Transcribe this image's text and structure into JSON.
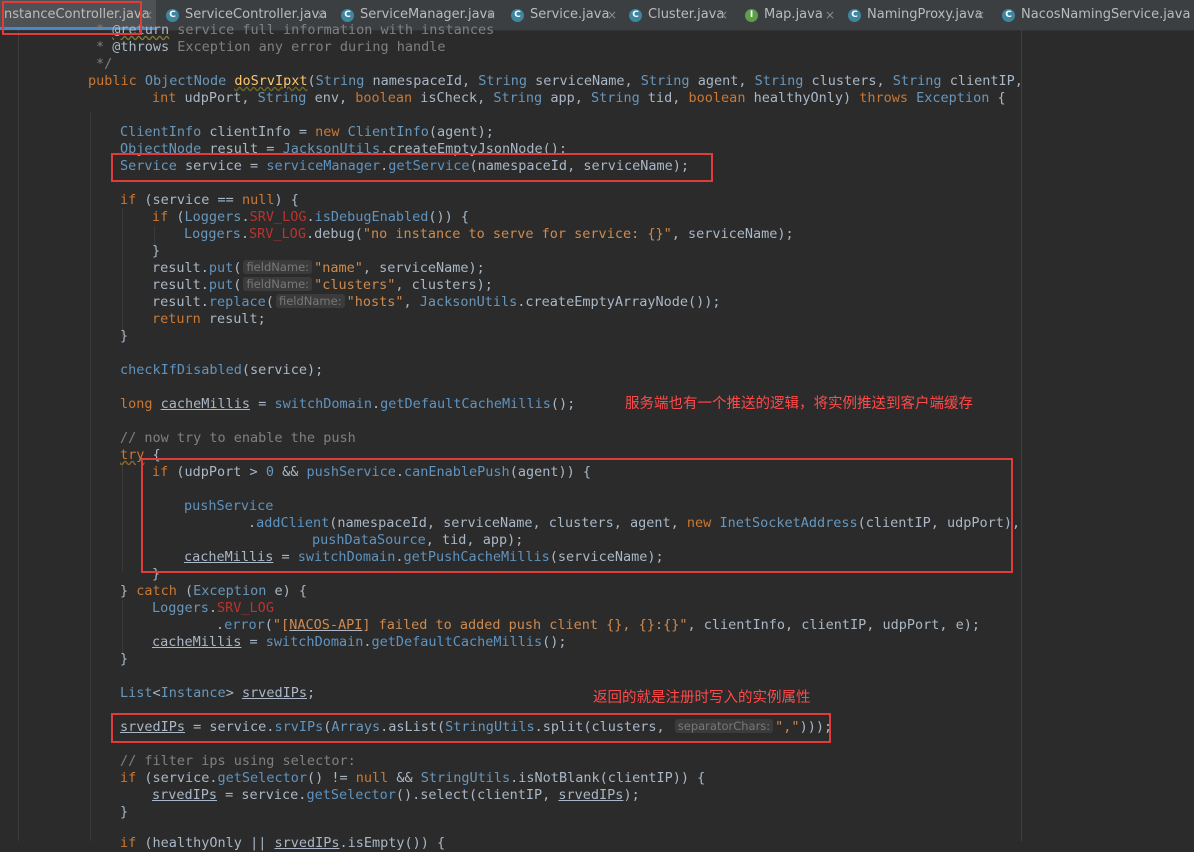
{
  "tabs": [
    {
      "name": "InstanceController.java",
      "display": "nstanceController.java",
      "icon": "class-icon",
      "active": true
    },
    {
      "name": "ServiceController.java",
      "display": "ServiceController.java",
      "icon": "class-icon",
      "active": false
    },
    {
      "name": "ServiceManager.java",
      "display": "ServiceManager.java",
      "icon": "class-icon",
      "active": false
    },
    {
      "name": "Service.java",
      "display": "Service.java",
      "icon": "class-icon",
      "active": false
    },
    {
      "name": "Cluster.java",
      "display": "Cluster.java",
      "icon": "class-icon",
      "active": false
    },
    {
      "name": "Map.java",
      "display": "Map.java",
      "icon": "interface-icon",
      "active": false
    },
    {
      "name": "NamingProxy.java",
      "display": "NamingProxy.java",
      "icon": "class-icon",
      "active": false
    },
    {
      "name": "NacosNamingService.java",
      "display": "NacosNamingService.java",
      "icon": "class-icon",
      "active": false
    }
  ],
  "tab_close_glyph": "×",
  "icon_glyphs": {
    "class-icon": "C",
    "interface-icon": "I"
  },
  "hints": {
    "field_name": "fieldName:",
    "separator_chars": "separatorChars:"
  },
  "annotations": {
    "push_note": "服务端也有一个推送的逻辑，将实例推送到客户端缓存",
    "return_note": "返回的就是注册时写入的实例属性"
  },
  "code": {
    "l0a": "* ",
    "l0b": "@return",
    "l0c": " service full information with instances",
    "l1a": "* ",
    "l1b": "@throws",
    "l1c": " Exception any error during handle",
    "l2": "*/",
    "l3a": "public",
    "l3b": "ObjectNode",
    "l3c": "doSrvIpxt",
    "l3d": "(",
    "l3e": "String",
    "l3f": " namespaceId, ",
    "l3g": "String",
    "l3h": " serviceName, ",
    "l3i": "String",
    "l3j": " agent, ",
    "l3k": "String",
    "l3l": " clusters, ",
    "l3m": "String",
    "l3n": " clientIP,",
    "l4a": "int",
    "l4b": " udpPort, ",
    "l4c": "String",
    "l4d": " env, ",
    "l4e": "boolean",
    "l4f": " isCheck, ",
    "l4g": "String",
    "l4h": " app, ",
    "l4i": "String",
    "l4j": " tid, ",
    "l4k": "boolean",
    "l4l": " healthyOnly) ",
    "l4m": "throws",
    "l4n": "Exception",
    "l4o": " {",
    "l5a": "ClientInfo",
    "l5b": " clientInfo = ",
    "l5c": "new",
    "l5d": "ClientInfo",
    "l5e": "(agent);",
    "l6a": "ObjectNode",
    "l6b": " result = ",
    "l6c": "JacksonUtils",
    "l6d": ".createEmptyJsonNode();",
    "l7a": "Service",
    "l7b": " service = ",
    "l7c": "serviceManager",
    "l7d": ".",
    "l7e": "getService",
    "l7f": "(namespaceId, serviceName);",
    "l8a": "if",
    "l8b": " (service == ",
    "l8c": "null",
    "l8d": ") {",
    "l9a": "if",
    "l9b": " (",
    "l9c": "Loggers",
    "l9d": ".",
    "l9e": "SRV_LOG",
    "l9f": ".",
    "l9g": "isDebugEnabled",
    "l9h": "()) {",
    "l10a": "Loggers",
    "l10b": ".",
    "l10c": "SRV_LOG",
    "l10d": ".debug(",
    "l10e": "\"no instance to serve for service: {}\"",
    "l10f": ", serviceName);",
    "l11": "}",
    "l12a": "result.",
    "l12b": "put",
    "l12c": "(",
    "l12d": "\"name\"",
    "l12e": ", serviceName);",
    "l13a": "result.",
    "l13b": "put",
    "l13c": "(",
    "l13d": "\"clusters\"",
    "l13e": ", clusters);",
    "l14a": "result.",
    "l14b": "replace",
    "l14c": "(",
    "l14d": "\"hosts\"",
    "l14e": ", ",
    "l14f": "JacksonUtils",
    "l14g": ".createEmptyArrayNode());",
    "l15a": "return",
    "l15b": " result;",
    "l16": "}",
    "l17a": "checkIfDisabled",
    "l17b": "(service);",
    "l18a": "long",
    "l18b": "cacheMillis",
    "l18c": " = ",
    "l18d": "switchDomain",
    "l18e": ".",
    "l18f": "getDefaultCacheMillis",
    "l18g": "();",
    "l19": "// now try to enable the push",
    "l20a": "try",
    "l20b": " {",
    "l21a": "if",
    "l21b": " (udpPort > ",
    "l21c": "0",
    "l21d": " && ",
    "l21e": "pushService",
    "l21f": ".",
    "l21g": "canEnablePush",
    "l21h": "(agent)) {",
    "l22": "pushService",
    "l23a": ".",
    "l23b": "addClient",
    "l23c": "(namespaceId, serviceName, clusters, agent, ",
    "l23d": "new",
    "l23e": "InetSocketAddress",
    "l23f": "(clientIP, udpPort),",
    "l24a": "pushDataSource",
    "l24b": ", tid, app);",
    "l25a": "cacheMillis",
    "l25b": " = ",
    "l25c": "switchDomain",
    "l25d": ".",
    "l25e": "getPushCacheMillis",
    "l25f": "(serviceName);",
    "l26": "}",
    "l27a": "} ",
    "l27b": "catch",
    "l27c": " (",
    "l27d": "Exception",
    "l27e": " e) {",
    "l28a": "Loggers",
    "l28b": ".",
    "l28c": "SRV_LOG",
    "l29a": ".",
    "l29b": "error",
    "l29c": "(",
    "l29d": "\"[",
    "l29e": "NACOS-API",
    "l29f": "] failed to added push client {}, {}:{}\"",
    "l29g": ", clientInfo, clientIP, udpPort, e);",
    "l30a": "cacheMillis",
    "l30b": " = ",
    "l30c": "switchDomain",
    "l30d": ".",
    "l30e": "getDefaultCacheMillis",
    "l30f": "();",
    "l31": "}",
    "l32a": "List",
    "l32b": "<",
    "l32c": "Instance",
    "l32d": "> ",
    "l32e": "srvedIPs",
    "l32f": ";",
    "l33a": "srvedIPs",
    "l33b": " = service.",
    "l33c": "srvIPs",
    "l33d": "(",
    "l33e": "Arrays",
    "l33f": ".asList(",
    "l33g": "StringUtils",
    "l33h": ".split(clusters, ",
    "l33i": "\",\"",
    "l33j": ")));",
    "l34": "// filter ips using selector:",
    "l35a": "if",
    "l35b": " (service.",
    "l35c": "getSelector",
    "l35d": "() != ",
    "l35e": "null",
    "l35f": " && ",
    "l35g": "StringUtils",
    "l35h": ".isNotBlank(clientIP)) {",
    "l36a": "srvedIPs",
    "l36b": " = service.",
    "l36c": "getSelector",
    "l36d": "().select(clientIP, ",
    "l36e": "srvedIPs",
    "l36f": ");",
    "l37": "}",
    "l38a": "if",
    "l38b": " (",
    "l38c": "healthyOnly",
    "l38d": " || ",
    "l38e": "srvedIPs",
    "l38f": ".isEmpty()) {"
  }
}
